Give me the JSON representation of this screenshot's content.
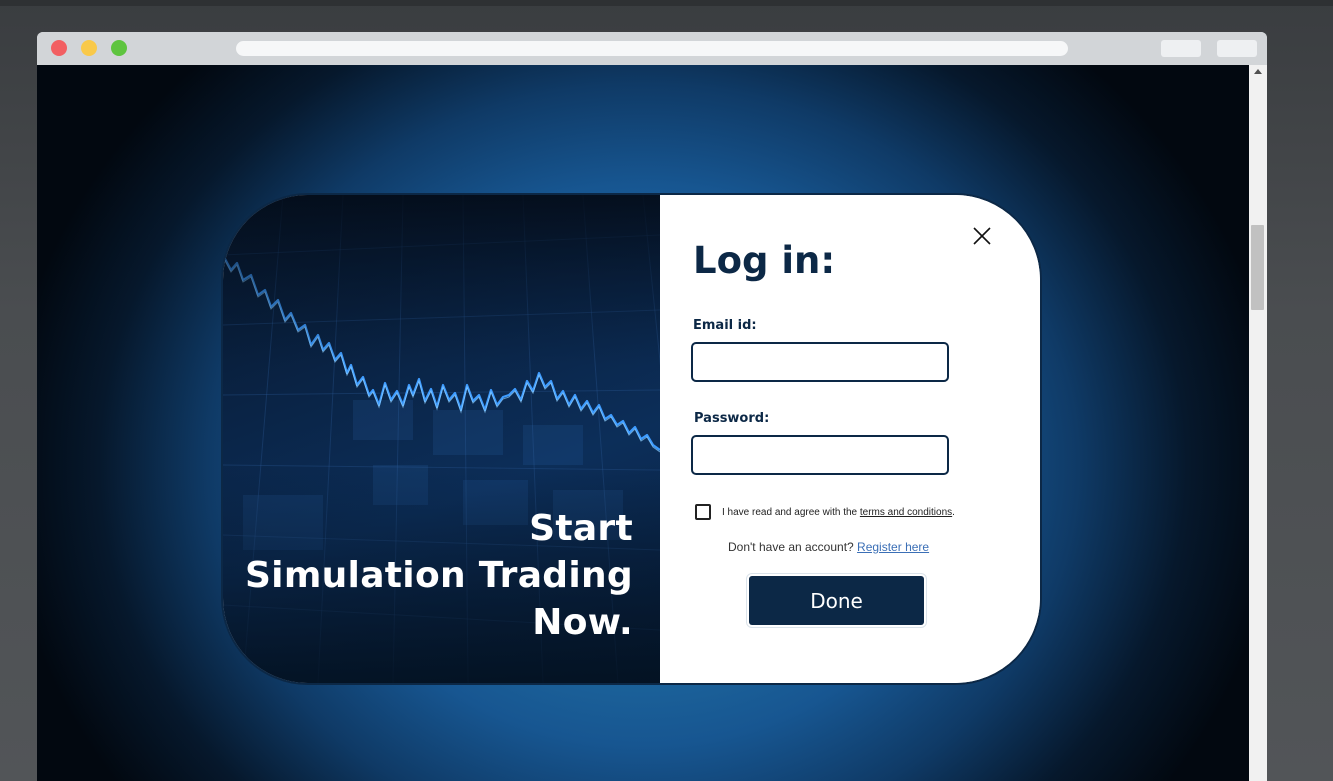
{
  "browser": {
    "traffic_lights": [
      "close",
      "minimize",
      "zoom"
    ],
    "colors": {
      "close": "#f25f62",
      "minimize": "#f9c94a",
      "zoom": "#5ec43f"
    }
  },
  "hero": {
    "lines": [
      "Start",
      "Simulation Trading",
      "Now."
    ]
  },
  "login": {
    "title": "Log in:",
    "email_label": "Email id:",
    "email_value": "",
    "password_label": "Password:",
    "password_value": "",
    "terms_prefix": "I have read and agree with the ",
    "terms_link": "terms and conditions",
    "terms_suffix": ".",
    "register_prompt": "Don't have an account? ",
    "register_link": "Register here",
    "done_label": "Done",
    "close_icon": "close-icon"
  },
  "colors": {
    "navy": "#0c2846",
    "link": "#3b6fb6"
  }
}
